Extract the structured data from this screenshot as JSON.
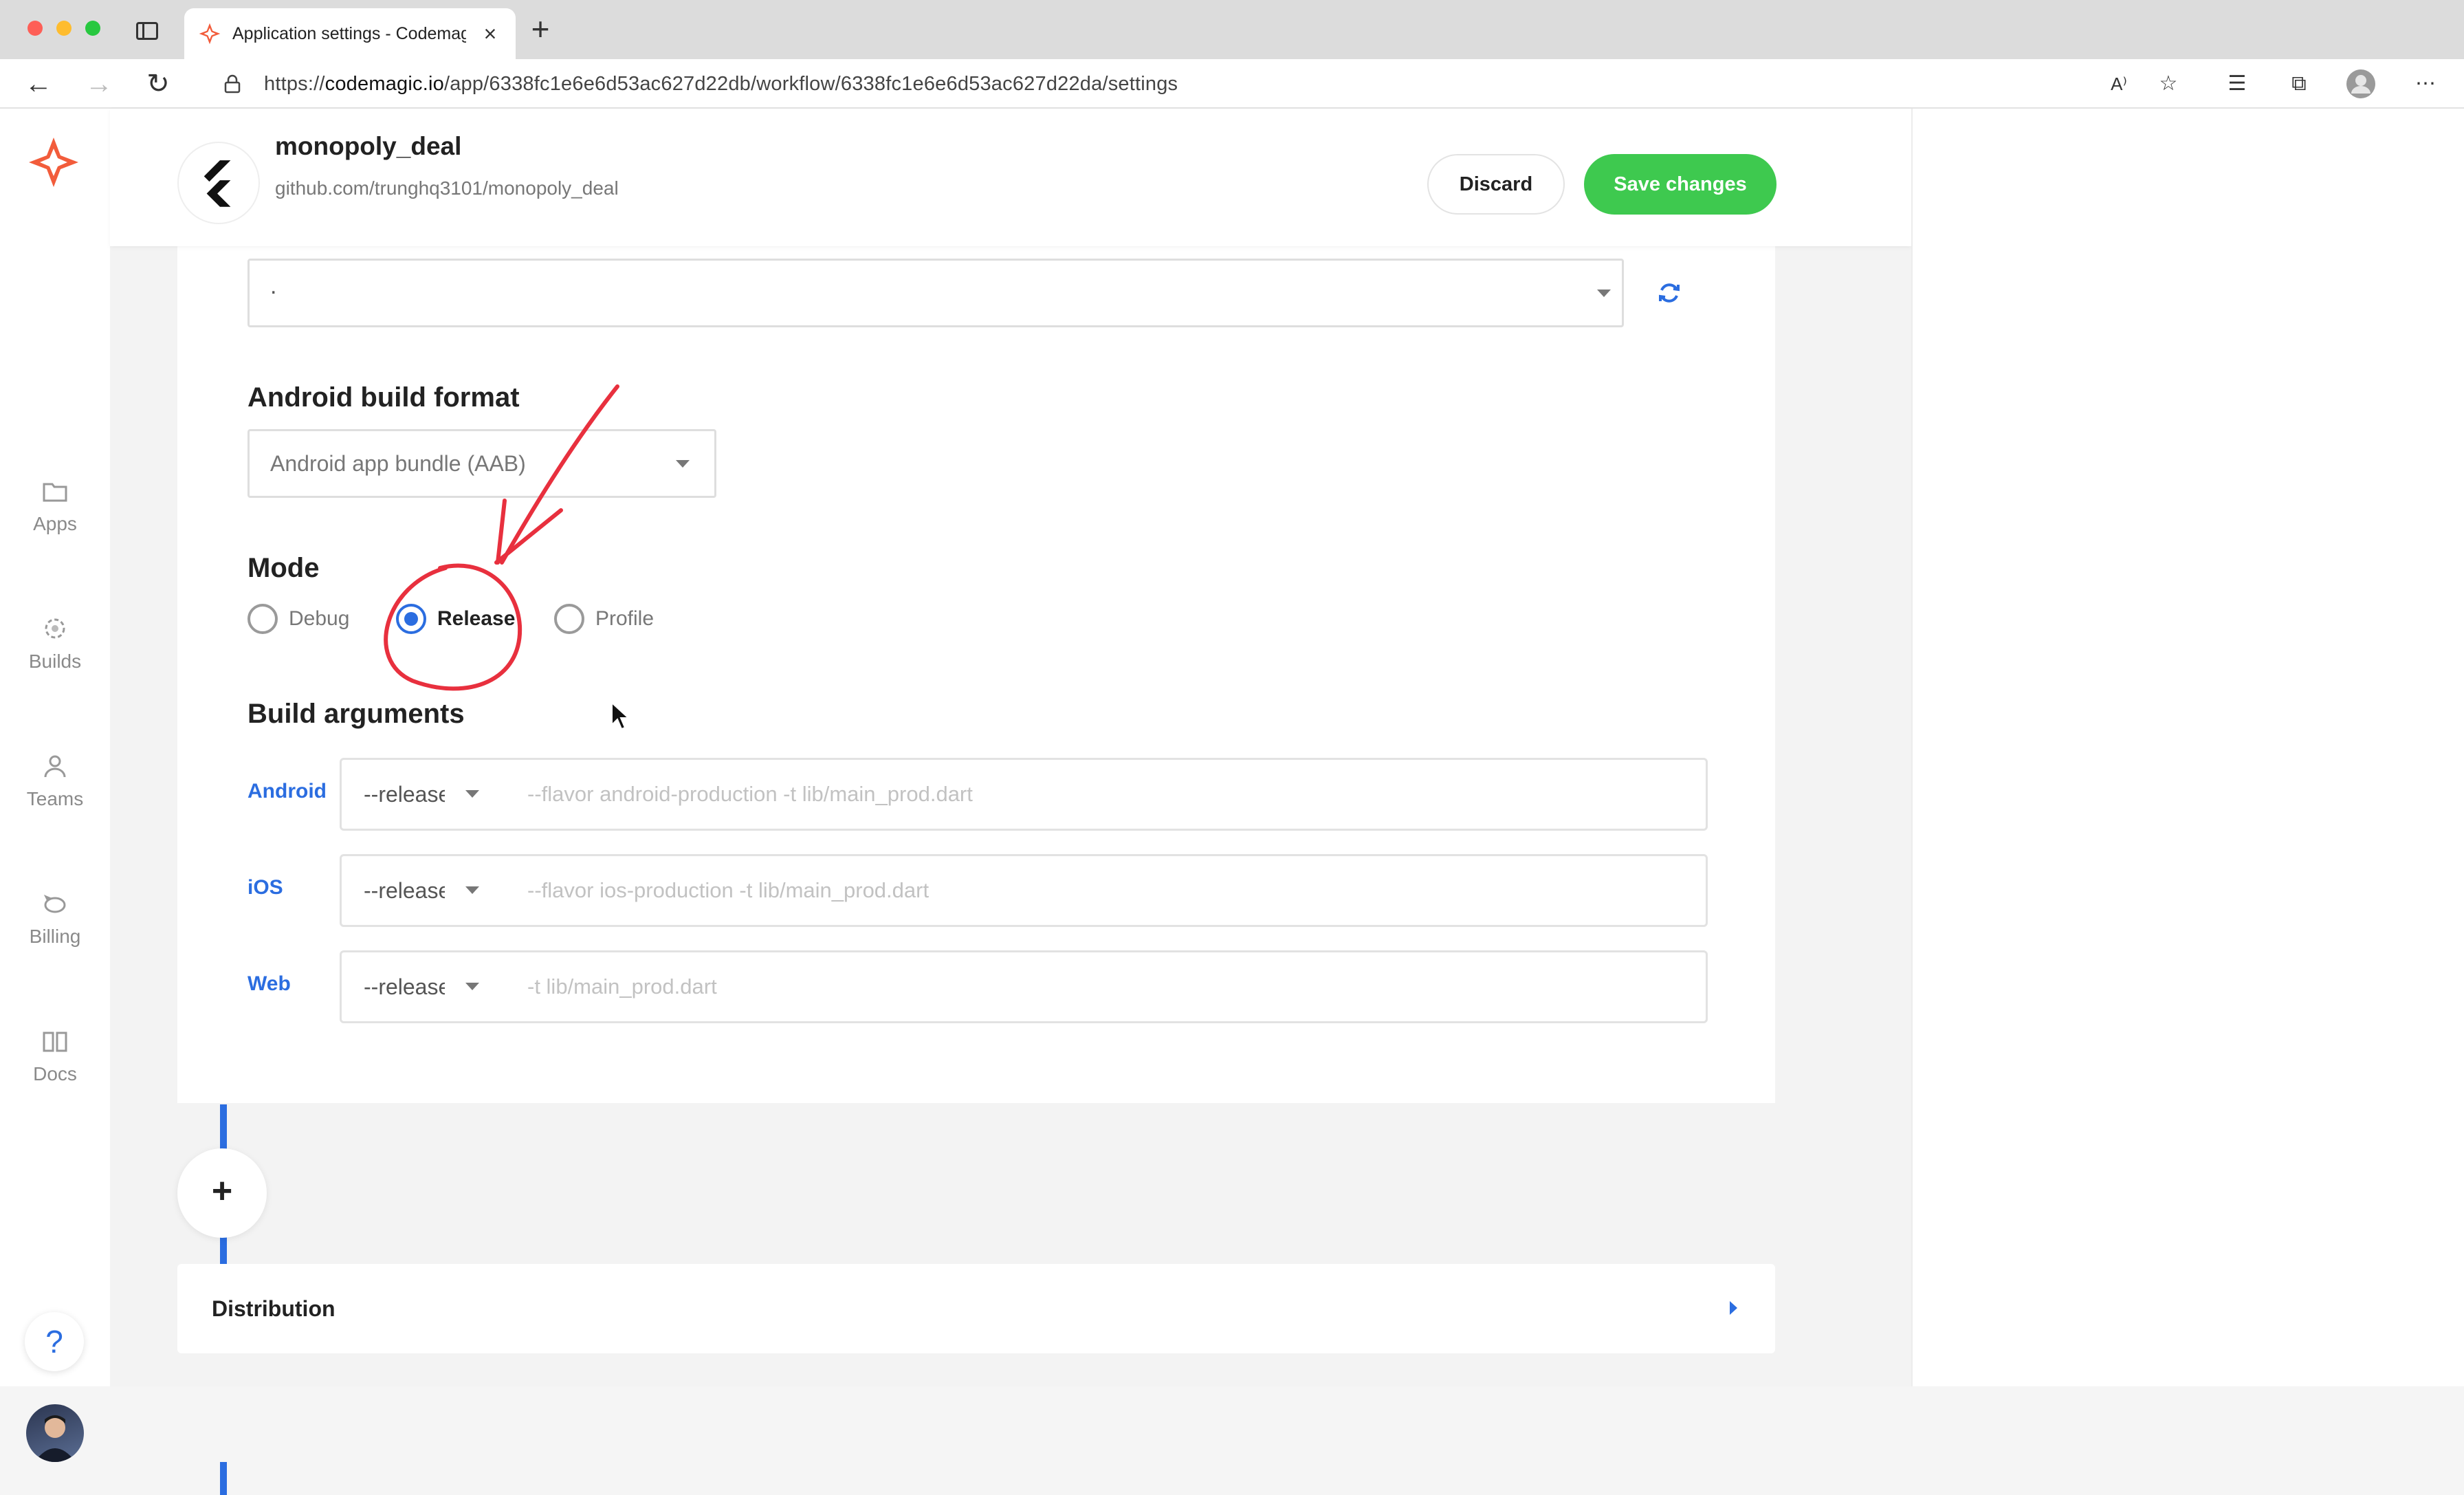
{
  "browser": {
    "tab_title": "Application settings - Codemagic",
    "tab_close": "×",
    "new_tab": "+",
    "url_prefix": "https://",
    "url_host": "codemagic.io",
    "url_path": "/app/6338fc1e6e6d53ac627d22db/workflow/6338fc1e6e6d53ac627d22da/settings"
  },
  "nav": {
    "items": [
      {
        "label": "Apps",
        "icon": "folder-icon"
      },
      {
        "label": "Builds",
        "icon": "builds-icon"
      },
      {
        "label": "Teams",
        "icon": "person-icon"
      },
      {
        "label": "Billing",
        "icon": "piggy-bank-icon"
      },
      {
        "label": "Docs",
        "icon": "book-icon"
      }
    ],
    "help": "?"
  },
  "header": {
    "app_name": "monopoly_deal",
    "repo": "github.com/trunghq3101/monopoly_deal",
    "discard_label": "Discard",
    "save_label": "Save changes"
  },
  "settings": {
    "top_select_value": ".",
    "android_format_title": "Android build format",
    "android_format_value": "Android app bundle (AAB)",
    "mode_title": "Mode",
    "mode_options": [
      "Debug",
      "Release",
      "Profile"
    ],
    "mode_selected": "Release",
    "build_args_title": "Build arguments",
    "build_args": [
      {
        "platform": "Android",
        "mode": "--release",
        "placeholder": "--flavor android-production -t lib/main_prod.dart"
      },
      {
        "platform": "iOS",
        "mode": "--release",
        "placeholder": "--flavor ios-production -t lib/main_prod.dart"
      },
      {
        "platform": "Web",
        "mode": "--release",
        "placeholder": "-t lib/main_prod.dart"
      }
    ]
  },
  "add_step": "+",
  "distribution_label": "Distribution",
  "colors": {
    "accent_blue": "#2b6de0",
    "save_green": "#3ec94f",
    "annotation_red": "#e8303e"
  }
}
